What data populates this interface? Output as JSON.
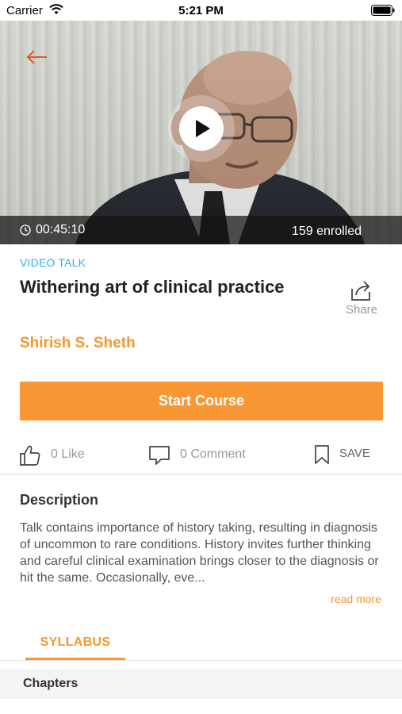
{
  "status_bar": {
    "carrier": "Carrier",
    "time": "5:21 PM"
  },
  "video": {
    "duration": "00:45:10",
    "enrolled": "159 enrolled",
    "icons": [
      "back-arrow-icon",
      "play-icon",
      "clock-icon"
    ]
  },
  "course": {
    "category": "VIDEO TALK",
    "title": "Withering art of clinical practice",
    "share_label": "Share",
    "author": "Shirish S. Sheth",
    "start_button": "Start Course"
  },
  "actions": {
    "like": "0 Like",
    "comment": "0 Comment",
    "save": "SAVE"
  },
  "description": {
    "heading": "Description",
    "text": "Talk contains importance of history taking, resulting in diagnosis of uncommon to rare conditions. History invites further thinking and careful clinical examination brings closer to the diagnosis or hit the same. Occasionally, eve...",
    "read_more": "read more"
  },
  "tabs": {
    "syllabus": "SYLLABUS"
  },
  "chapters": {
    "label": "Chapters"
  },
  "colors": {
    "accent": "#f7972d",
    "category": "#2ab3e6",
    "button": "#f89733",
    "back_arrow": "#e8552a"
  }
}
